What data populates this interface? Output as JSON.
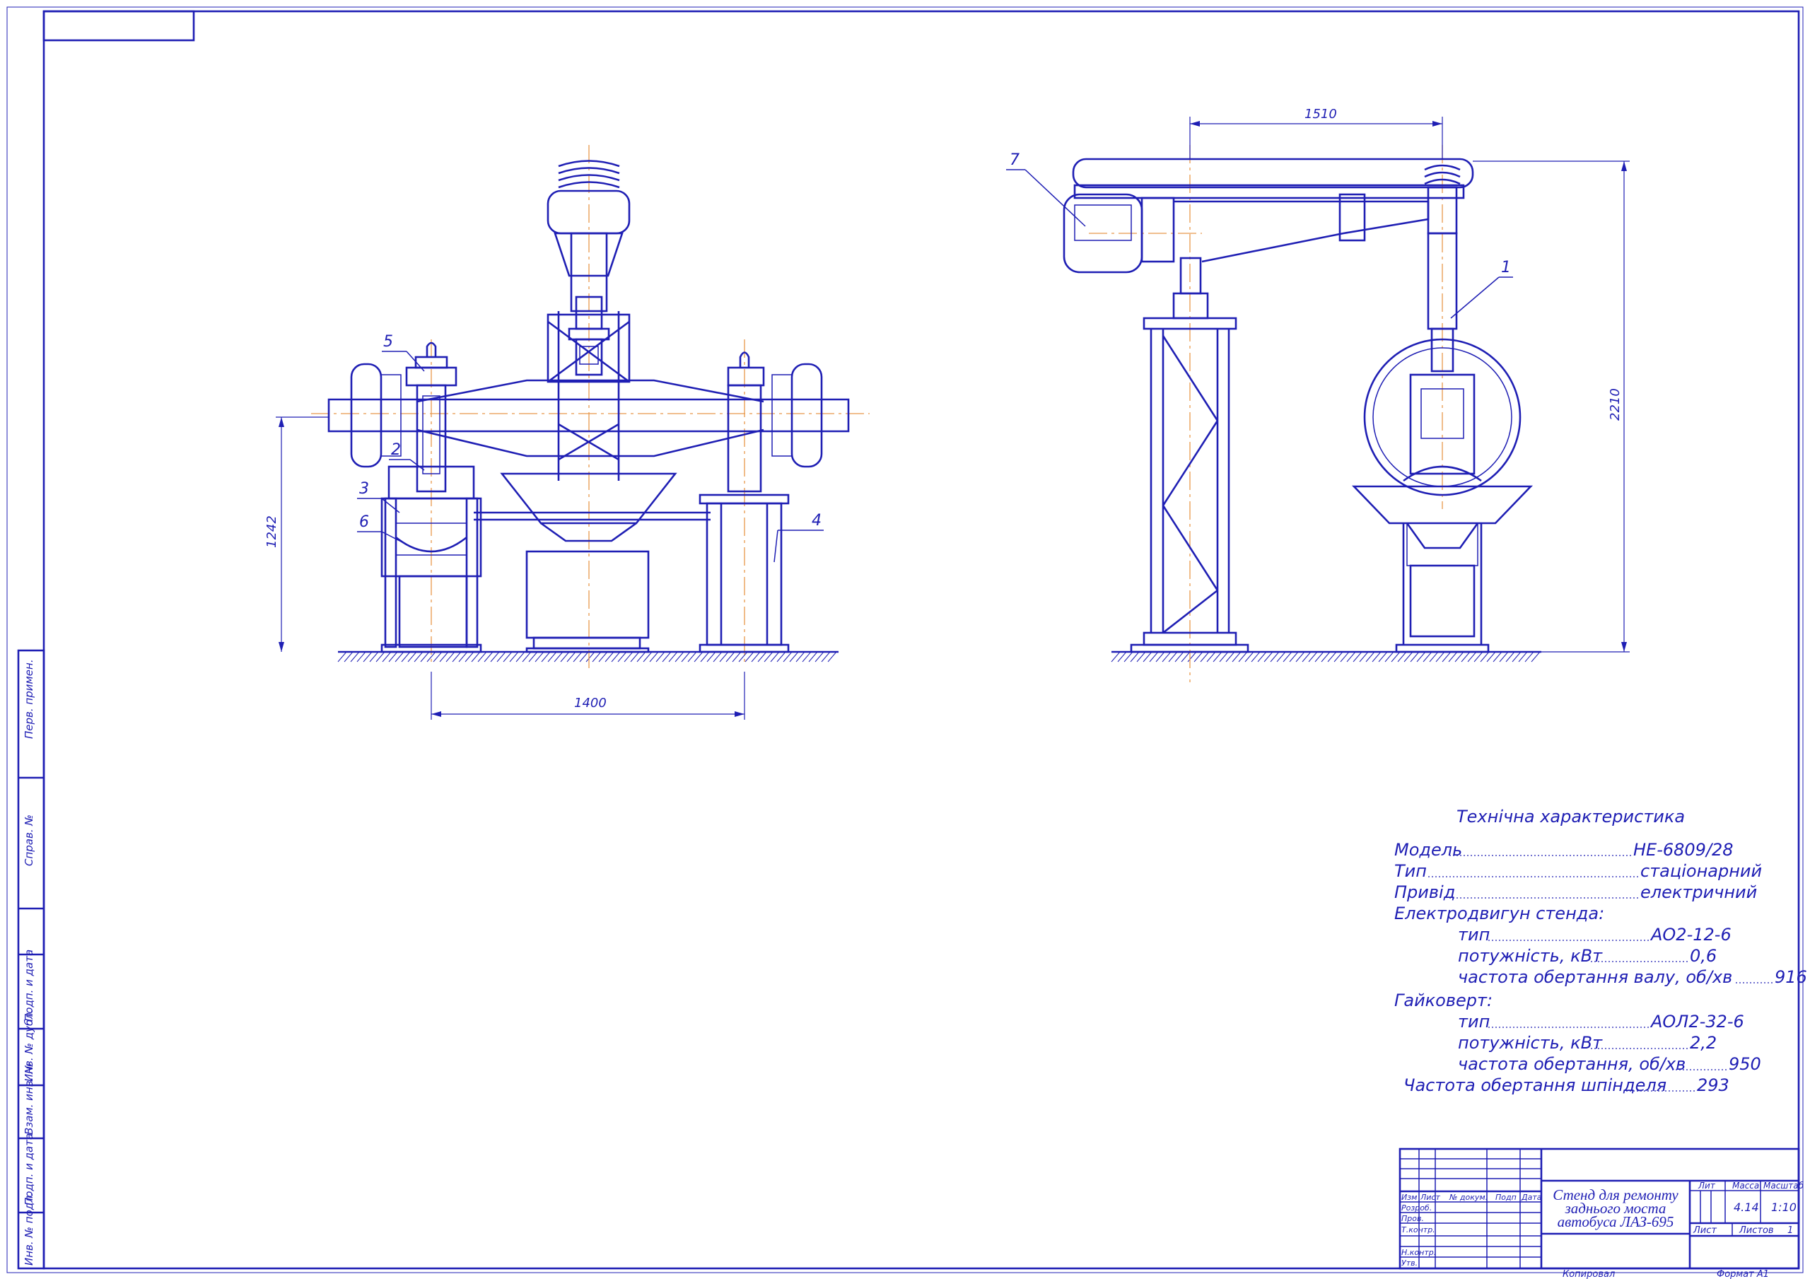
{
  "drawing_title": [
    "Стенд для ремонту",
    "заднього моста",
    "автобуса ЛАЗ-695"
  ],
  "dimensions": {
    "axle_height": "1242",
    "track_width": "1400",
    "arm_reach": "1510",
    "total_height": "2210"
  },
  "callouts": [
    "1",
    "2",
    "3",
    "4",
    "5",
    "6",
    "7"
  ],
  "spec": {
    "heading": "Технічна характеристика",
    "lines": [
      {
        "label": "Модель",
        "value": "НЕ-6809/28"
      },
      {
        "label": "Тип",
        "value": "стаціонарний"
      },
      {
        "label": "Привід",
        "value": "електричний"
      },
      {
        "label": "Електродвигун стенда:",
        "value": ""
      },
      {
        "label": "тип",
        "value": "АО2-12-6"
      },
      {
        "label": "потужність, кВт",
        "value": "0,6"
      },
      {
        "label": "частота обертання валу, об/хв",
        "value": "916"
      },
      {
        "label": "Гайковерт:",
        "value": ""
      },
      {
        "label": "тип",
        "value": "АОЛ2-32-6"
      },
      {
        "label": "потужність, кВт",
        "value": "2,2"
      },
      {
        "label": "частота обертання, об/хв",
        "value": "950"
      },
      {
        "label": "Частота обертання шпінделя",
        "value": "293"
      }
    ]
  },
  "title_block": {
    "rev_headers": [
      "Изм",
      "Лист",
      "№ докум.",
      "Подп",
      "Дата"
    ],
    "roles": [
      "Розроб.",
      "Пров.",
      "Т.контр.",
      "Н.контр.",
      "Утв."
    ],
    "lit_label": "Лит",
    "mass_label": "Масса",
    "scale_label": "Масштаб",
    "mass_value": "4.14",
    "scale_value": "1:10",
    "sheet_label": "Лист",
    "sheets_label": "Листов",
    "sheets_value": "1",
    "copied": "Копировал",
    "format": "Формат   А1"
  },
  "side_stamp": [
    "Перв. примен.",
    "Справ. №",
    "Подп. и дата",
    "Инв. № дубл.",
    "Взам. инв. №",
    "Подп. и дата",
    "Инв. № подл."
  ]
}
